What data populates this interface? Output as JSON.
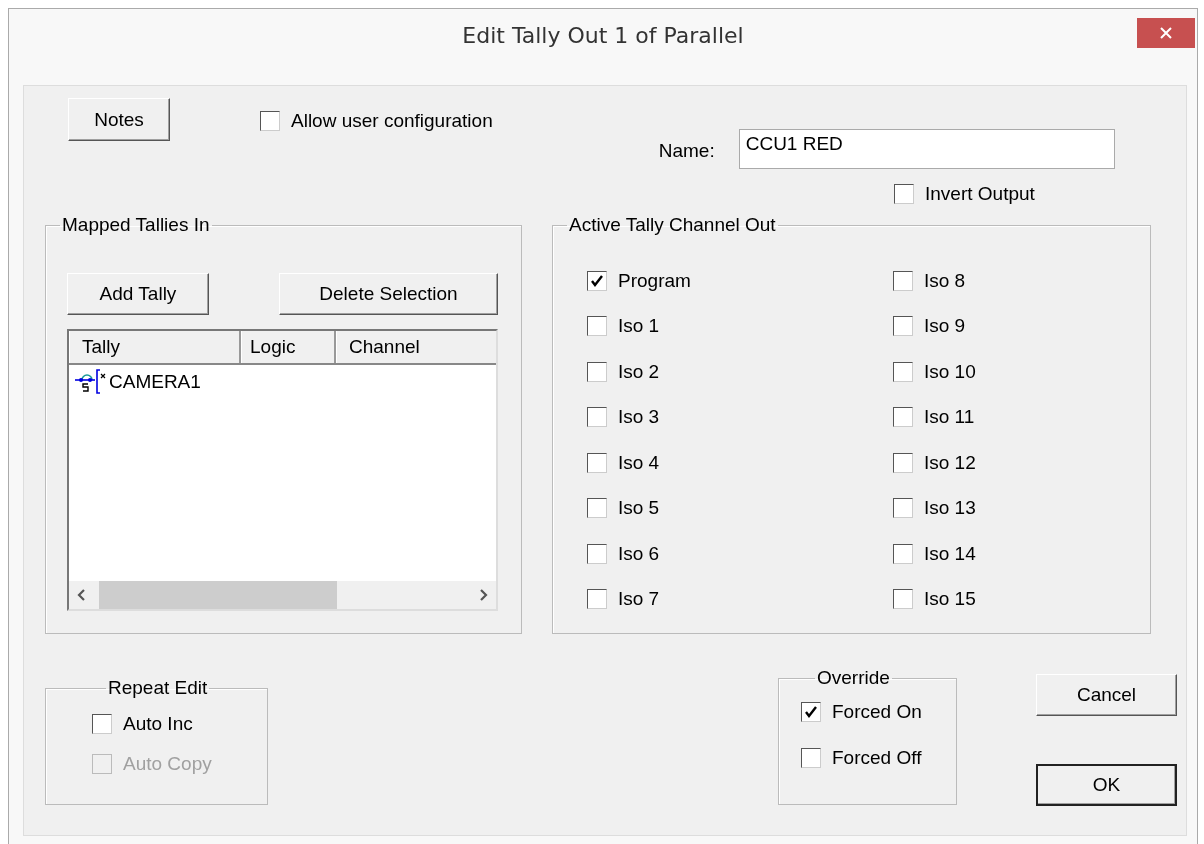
{
  "window": {
    "title": "Edit Tally Out 1 of Parallel"
  },
  "notes_button": "Notes",
  "allow_user_configuration": {
    "label": "Allow user configuration",
    "checked": false
  },
  "name": {
    "label": "Name:",
    "value": "CCU1 RED"
  },
  "invert_output": {
    "label": "Invert Output",
    "checked": false
  },
  "mapped_tallies_in": {
    "title": "Mapped Tallies In",
    "buttons": [
      "Add Tally",
      "Delete Selection"
    ],
    "columns": [
      "Tally",
      "Logic",
      "Channel"
    ],
    "rows": [
      {
        "tally": "CAMERA1"
      }
    ]
  },
  "active_tally_channel_out": {
    "title": "Active Tally Channel Out",
    "channels": [
      {
        "label": "Program",
        "checked": true
      },
      {
        "label": "Iso 1",
        "checked": false
      },
      {
        "label": "Iso 2",
        "checked": false
      },
      {
        "label": "Iso 3",
        "checked": false
      },
      {
        "label": "Iso 4",
        "checked": false
      },
      {
        "label": "Iso 5",
        "checked": false
      },
      {
        "label": "Iso 6",
        "checked": false
      },
      {
        "label": "Iso 7",
        "checked": false
      },
      {
        "label": "Iso 8",
        "checked": false
      },
      {
        "label": "Iso 9",
        "checked": false
      },
      {
        "label": "Iso 10",
        "checked": false
      },
      {
        "label": "Iso 11",
        "checked": false
      },
      {
        "label": "Iso 12",
        "checked": false
      },
      {
        "label": "Iso 13",
        "checked": false
      },
      {
        "label": "Iso 14",
        "checked": false
      },
      {
        "label": "Iso 15",
        "checked": false
      }
    ]
  },
  "repeat_edit": {
    "title": "Repeat Edit",
    "options": [
      {
        "label": "Auto Inc",
        "checked": false,
        "disabled": false
      },
      {
        "label": "Auto Copy",
        "checked": false,
        "disabled": true
      }
    ]
  },
  "override": {
    "title": "Override",
    "options": [
      {
        "label": "Forced On",
        "checked": true
      },
      {
        "label": "Forced Off",
        "checked": false
      }
    ]
  },
  "buttons": [
    "Cancel",
    "OK"
  ]
}
